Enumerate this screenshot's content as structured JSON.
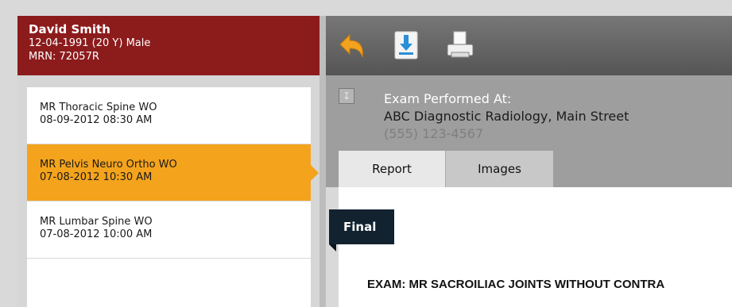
{
  "patient": {
    "name": "David Smith",
    "details": "12-04-1991 (20 Y) Male",
    "mrn": "MRN: 72057R"
  },
  "exams": [
    {
      "title": "MR Thoracic Spine WO",
      "datetime": "08-09-2012 08:30 AM",
      "selected": false
    },
    {
      "title": "MR Pelvis Neuro Ortho WO",
      "datetime": "07-08-2012 10:30 AM",
      "selected": true
    },
    {
      "title": "MR Lumbar Spine WO",
      "datetime": "07-08-2012 10:00 AM",
      "selected": false
    }
  ],
  "toolbar": {
    "icons": [
      "undo-arrow-icon",
      "download-icon",
      "print-icon"
    ]
  },
  "performed": {
    "label": "Exam Performed At:",
    "place": "ABC Diagnostic Radiology, Main Street",
    "phone": "(555) 123-4567"
  },
  "tabs": {
    "report": "Report",
    "images": "Images"
  },
  "report": {
    "status": "Final",
    "exam_line": "EXAM:  MR SACROILIAC JOINTS WITHOUT CONTRA"
  },
  "colors": {
    "patient_header": "#8c1b1c",
    "selected_exam": "#f4a31c",
    "final_badge": "#12222f"
  }
}
